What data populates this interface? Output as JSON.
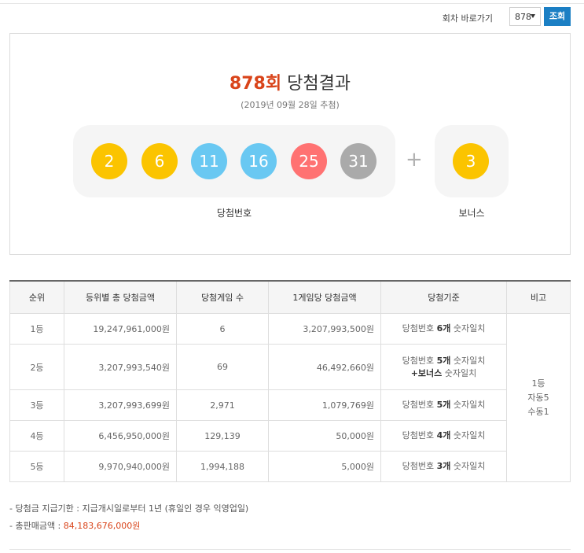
{
  "round_nav": {
    "label": "회차 바로가기",
    "selected_round": "878",
    "button": "조회"
  },
  "result": {
    "round_num": "878회",
    "title_suffix": " 당첨결과",
    "date": "(2019년 09월 28일 추첨)",
    "numbers": [
      "2",
      "6",
      "11",
      "16",
      "25",
      "31"
    ],
    "number_colors": [
      "#fbc400",
      "#fbc400",
      "#69c8f2",
      "#69c8f2",
      "#ff7272",
      "#aaaaaa"
    ],
    "plus": "+",
    "bonus": "3",
    "bonus_color": "#fbc400",
    "numbers_label": "당첨번호",
    "bonus_label": "보너스"
  },
  "table": {
    "headers": [
      "순위",
      "등위별 총 당첨금액",
      "당첨게임 수",
      "1게임당 당첨금액",
      "당첨기준",
      "비고"
    ],
    "rows": [
      {
        "rank": "1등",
        "total": "19,247,961,000원",
        "count": "6",
        "per_game": "3,207,993,500원",
        "crit_pre": "당첨번호 ",
        "crit_bold": "6개",
        "crit_post": " 숫자일치"
      },
      {
        "rank": "2등",
        "total": "3,207,993,540원",
        "count": "69",
        "per_game": "46,492,660원",
        "crit_pre": "당첨번호 ",
        "crit_bold": "5개",
        "crit_post": " 숫자일치",
        "crit_line2_bold": "+보너스",
        "crit_line2_post": " 숫자일치"
      },
      {
        "rank": "3등",
        "total": "3,207,993,699원",
        "count": "2,971",
        "per_game": "1,079,769원",
        "crit_pre": "당첨번호 ",
        "crit_bold": "5개",
        "crit_post": " 숫자일치"
      },
      {
        "rank": "4등",
        "total": "6,456,950,000원",
        "count": "129,139",
        "per_game": "50,000원",
        "crit_pre": "당첨번호 ",
        "crit_bold": "4개",
        "crit_post": " 숫자일치"
      },
      {
        "rank": "5등",
        "total": "9,970,940,000원",
        "count": "1,994,188",
        "per_game": "5,000원",
        "crit_pre": "당첨번호 ",
        "crit_bold": "3개",
        "crit_post": " 숫자일치"
      }
    ],
    "note": {
      "line1": "1등",
      "line2": "자동5",
      "line3": "수동1"
    }
  },
  "notes": {
    "deadline": "- 당첨금 지급기한 : 지급개시일로부터 1년 (휴일인 경우 익영업일)",
    "sales_label": "- 총판매금액 : ",
    "sales_value": "84,183,676,000원"
  },
  "colors": {
    "accent_red": "#d9441a",
    "button_blue": "#1b7fc4"
  }
}
